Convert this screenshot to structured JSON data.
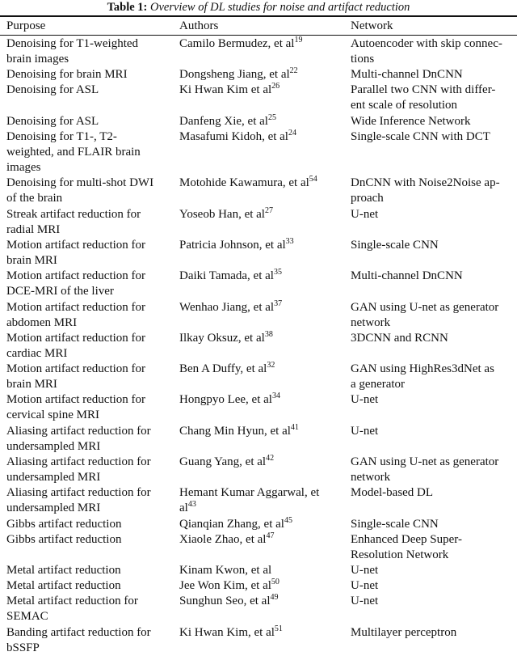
{
  "caption": {
    "label": "Table 1:",
    "text": "Overview of DL studies for noise and artifact reduction"
  },
  "headers": [
    "Purpose",
    "Authors",
    "Network"
  ],
  "rows": [
    {
      "purpose": [
        "Denoising for T1-weighted",
        "brain images"
      ],
      "author": "Camilo Bermudez, et al",
      "ref": "19",
      "author_line2": "",
      "network": [
        "Autoencoder with skip connec-",
        "tions"
      ]
    },
    {
      "purpose": [
        "Denoising for brain MRI"
      ],
      "author": "Dongsheng Jiang, et al",
      "ref": "22",
      "author_line2": "",
      "network": [
        "Multi-channel DnCNN"
      ]
    },
    {
      "purpose": [
        "Denoising for ASL"
      ],
      "author": "Ki Hwan Kim et al",
      "ref": "26",
      "author_line2": "",
      "network": [
        "Parallel two CNN with differ-",
        "ent scale of resolution"
      ]
    },
    {
      "purpose": [
        "Denoising for ASL"
      ],
      "author": "Danfeng Xie, et al",
      "ref": "25",
      "author_line2": "",
      "network": [
        "Wide Inference Network"
      ]
    },
    {
      "purpose": [
        "Denoising for T1-, T2-",
        "weighted, and FLAIR brain",
        "images"
      ],
      "author": "Masafumi Kidoh, et al",
      "ref": "24",
      "author_line2": "",
      "network": [
        "Single-scale CNN with DCT"
      ]
    },
    {
      "purpose": [
        "Denoising for multi-shot DWI",
        "of the brain"
      ],
      "author": "Motohide Kawamura, et al",
      "ref": "54",
      "author_line2": "",
      "network": [
        "DnCNN with Noise2Noise ap-",
        "proach"
      ]
    },
    {
      "purpose": [
        "Streak artifact reduction for",
        "radial MRI"
      ],
      "author": "Yoseob Han, et al",
      "ref": "27",
      "author_line2": "",
      "network": [
        "U-net"
      ]
    },
    {
      "purpose": [
        "Motion artifact reduction for",
        "brain MRI"
      ],
      "author": "Patricia Johnson, et al",
      "ref": "33",
      "author_line2": "",
      "network": [
        "Single-scale CNN"
      ]
    },
    {
      "purpose": [
        "Motion artifact reduction for",
        "DCE-MRI of the liver"
      ],
      "author": "Daiki Tamada, et al",
      "ref": "35",
      "author_line2": "",
      "network": [
        "Multi-channel DnCNN"
      ]
    },
    {
      "purpose": [
        "Motion artifact reduction for",
        "abdomen MRI"
      ],
      "author": "Wenhao Jiang, et al",
      "ref": "37",
      "author_line2": "",
      "network": [
        "GAN using U-net as generator",
        "network"
      ]
    },
    {
      "purpose": [
        "Motion artifact reduction for",
        "cardiac MRI"
      ],
      "author": "Ilkay Oksuz, et al",
      "ref": "38",
      "author_line2": "",
      "network": [
        "3DCNN and RCNN"
      ]
    },
    {
      "purpose": [
        "Motion artifact reduction for",
        "brain MRI"
      ],
      "author": "Ben A Duffy, et al",
      "ref": "32",
      "author_line2": "",
      "network": [
        "GAN using HighRes3dNet as",
        "a generator"
      ]
    },
    {
      "purpose": [
        "Motion artifact reduction for",
        "cervical spine MRI"
      ],
      "author": "Hongpyo Lee, et al",
      "ref": "34",
      "author_line2": "",
      "network": [
        "U-net"
      ]
    },
    {
      "purpose": [
        "Aliasing artifact reduction for",
        "undersampled MRI"
      ],
      "author": "Chang Min Hyun, et al",
      "ref": "41",
      "author_line2": "",
      "network": [
        "U-net"
      ]
    },
    {
      "purpose": [
        "Aliasing artifact reduction for",
        "undersampled MRI"
      ],
      "author": "Guang Yang, et al",
      "ref": "42",
      "author_line2": "",
      "network": [
        "GAN using U-net as generator",
        "network"
      ]
    },
    {
      "purpose": [
        "Aliasing artifact reduction for",
        "undersampled MRI"
      ],
      "author": "Hemant Kumar Aggarwal, et",
      "ref": "43",
      "author_line2": "al",
      "network": [
        "Model-based DL"
      ]
    },
    {
      "purpose": [
        "Gibbs artifact reduction"
      ],
      "author": "Qianqian Zhang, et al",
      "ref": "45",
      "author_line2": "",
      "network": [
        "Single-scale CNN"
      ]
    },
    {
      "purpose": [
        "Gibbs artifact reduction"
      ],
      "author": "Xiaole Zhao, et al",
      "ref": "47",
      "author_line2": "",
      "network": [
        "Enhanced Deep Super-",
        "Resolution Network"
      ]
    },
    {
      "purpose": [
        "Metal artifact reduction"
      ],
      "author": "Kinam Kwon, et al",
      "ref": "",
      "author_line2": "",
      "network": [
        "U-net"
      ]
    },
    {
      "purpose": [
        "Metal artifact reduction"
      ],
      "author": "Jee Won Kim, et al",
      "ref": "50",
      "author_line2": "",
      "network": [
        "U-net"
      ]
    },
    {
      "purpose": [
        "Metal artifact reduction for",
        "SEMAC"
      ],
      "author": "Sunghun Seo, et al",
      "ref": "49",
      "author_line2": "",
      "network": [
        "U-net"
      ]
    },
    {
      "purpose": [
        "Banding artifact reduction for",
        "bSSFP"
      ],
      "author": "Ki Hwan Kim, et al",
      "ref": "51",
      "author_line2": "",
      "network": [
        "Multilayer perceptron"
      ]
    }
  ]
}
